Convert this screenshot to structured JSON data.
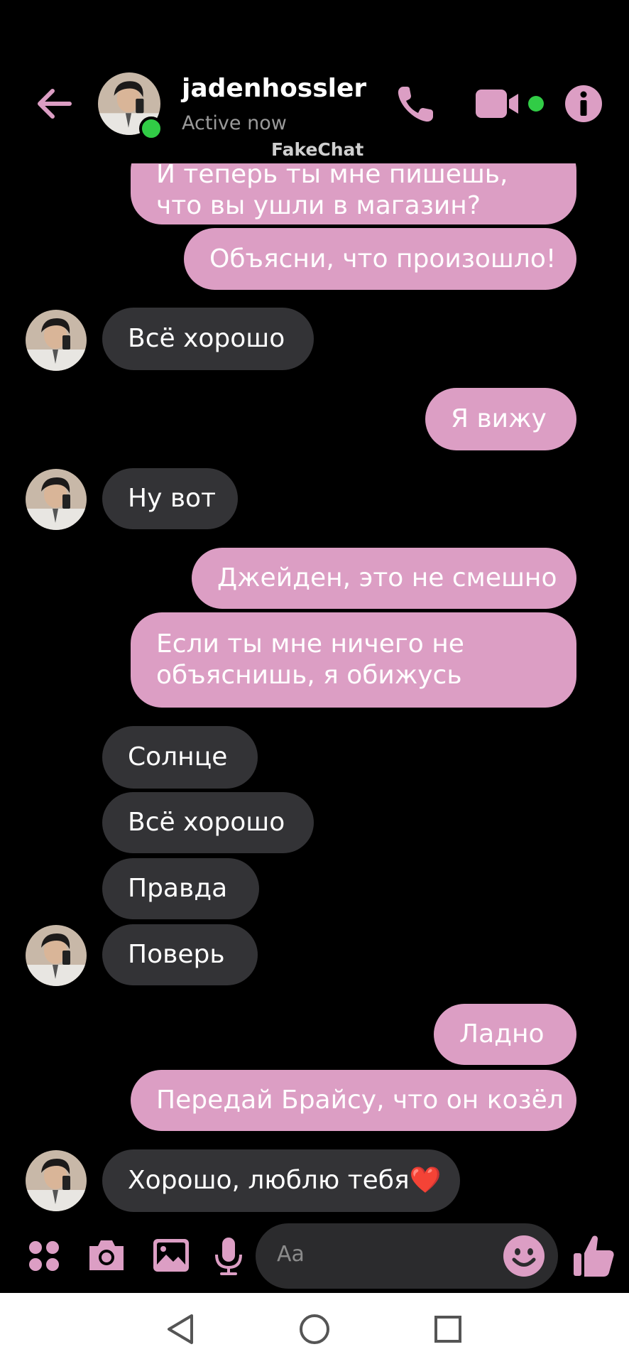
{
  "header": {
    "contact_name": "jadenhossler",
    "status": "Active now",
    "watermark": "FakeChat"
  },
  "messages": [
    {
      "side": "out",
      "text": "И теперь ты мне пишешь, что вы ушли в магазин?"
    },
    {
      "side": "out",
      "text": "Объясни, что произошло!"
    },
    {
      "side": "in",
      "text": "Всё хорошо"
    },
    {
      "side": "out",
      "text": "Я вижу"
    },
    {
      "side": "in",
      "text": "Ну вот"
    },
    {
      "side": "out",
      "text": "Джейден, это не смешно"
    },
    {
      "side": "out",
      "text": "Если ты мне ничего не объяснишь, я обижусь"
    },
    {
      "side": "in",
      "text": "Солнце"
    },
    {
      "side": "in",
      "text": "Всё хорошо"
    },
    {
      "side": "in",
      "text": "Правда"
    },
    {
      "side": "in",
      "text": "Поверь"
    },
    {
      "side": "out",
      "text": "Ладно"
    },
    {
      "side": "out",
      "text": "Передай Брайсу, что он козёл"
    },
    {
      "side": "in",
      "text": "Хорошо, люблю тебя❤️"
    }
  ],
  "composer": {
    "placeholder": "Aa"
  },
  "colors": {
    "accent": "#dc9ec4",
    "incoming_bubble": "#333336",
    "background": "#000000",
    "online": "#31cc46"
  },
  "icons": [
    "back-arrow-icon",
    "phone-icon",
    "video-camera-icon",
    "info-icon",
    "apps-icon",
    "camera-icon",
    "image-icon",
    "microphone-icon",
    "emoji-icon",
    "thumbs-up-icon",
    "nav-back-icon",
    "nav-home-icon",
    "nav-recents-icon"
  ]
}
